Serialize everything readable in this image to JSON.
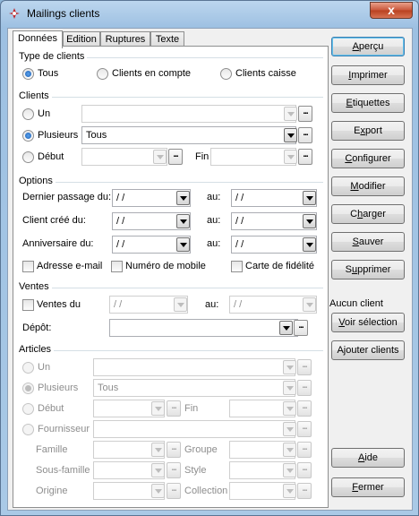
{
  "window": {
    "title": "Mailings clients",
    "close_glyph": "x"
  },
  "tabs": [
    {
      "label": "Données",
      "active": true
    },
    {
      "label": "Edition"
    },
    {
      "label": "Ruptures"
    },
    {
      "label": "Texte"
    }
  ],
  "type_clients": {
    "title": "Type de clients",
    "options": [
      "Tous",
      "Clients en compte",
      "Clients caisse"
    ],
    "selected": "Tous"
  },
  "clients": {
    "title": "Clients",
    "un_label": "Un",
    "plusieurs_label": "Plusieurs",
    "plusieurs_value": "Tous",
    "debut_label": "Début",
    "fin_label": "Fin",
    "selected": "Plusieurs"
  },
  "options": {
    "title": "Options",
    "dernier_passage_label": "Dernier passage du:",
    "client_cree_label": "Client créé du:",
    "anniversaire_label": "Anniversaire du:",
    "au_label": "au:",
    "date_placeholder": " /  /",
    "adresse_email_label": "Adresse e-mail",
    "numero_mobile_label": "Numéro de mobile",
    "carte_fidelite_label": "Carte de fidélité"
  },
  "ventes": {
    "title": "Ventes",
    "ventes_du_label": "Ventes du",
    "au_label": "au:",
    "date_placeholder": " /  /",
    "depot_label": "Dépôt:"
  },
  "articles": {
    "title": "Articles",
    "un_label": "Un",
    "plusieurs_label": "Plusieurs",
    "plusieurs_value": "Tous",
    "debut_label": "Début",
    "fin_label": "Fin",
    "fournisseur_label": "Fournisseur",
    "famille_label": "Famille",
    "groupe_label": "Groupe",
    "sous_famille_label": "Sous-famille",
    "style_label": "Style",
    "origine_label": "Origine",
    "collection_label": "Collection"
  },
  "ellipsis": "...",
  "sidebar": {
    "buttons": [
      {
        "u": "A",
        "rest": "perçu"
      },
      {
        "u": "I",
        "rest": "mprimer"
      },
      {
        "u": "E",
        "rest": "tiquettes"
      },
      {
        "pre": "E",
        "u": "x",
        "rest": "port"
      },
      {
        "u": "C",
        "rest": "onfigurer"
      },
      {
        "u": "M",
        "rest": "odifier"
      },
      {
        "pre": "C",
        "u": "h",
        "rest": "arger"
      },
      {
        "u": "S",
        "rest": "auver"
      },
      {
        "pre": "S",
        "u": "u",
        "rest": "pprimer"
      }
    ],
    "aucun_client": "Aucun client",
    "voir_selection": {
      "u": "V",
      "rest": "oir sélection"
    },
    "ajouter_clients": {
      "pre": "A",
      "u": "j",
      "rest": "outer clients"
    },
    "aide": {
      "u": "A",
      "rest": "ide"
    },
    "fermer": {
      "u": "F",
      "rest": "ermer"
    }
  }
}
